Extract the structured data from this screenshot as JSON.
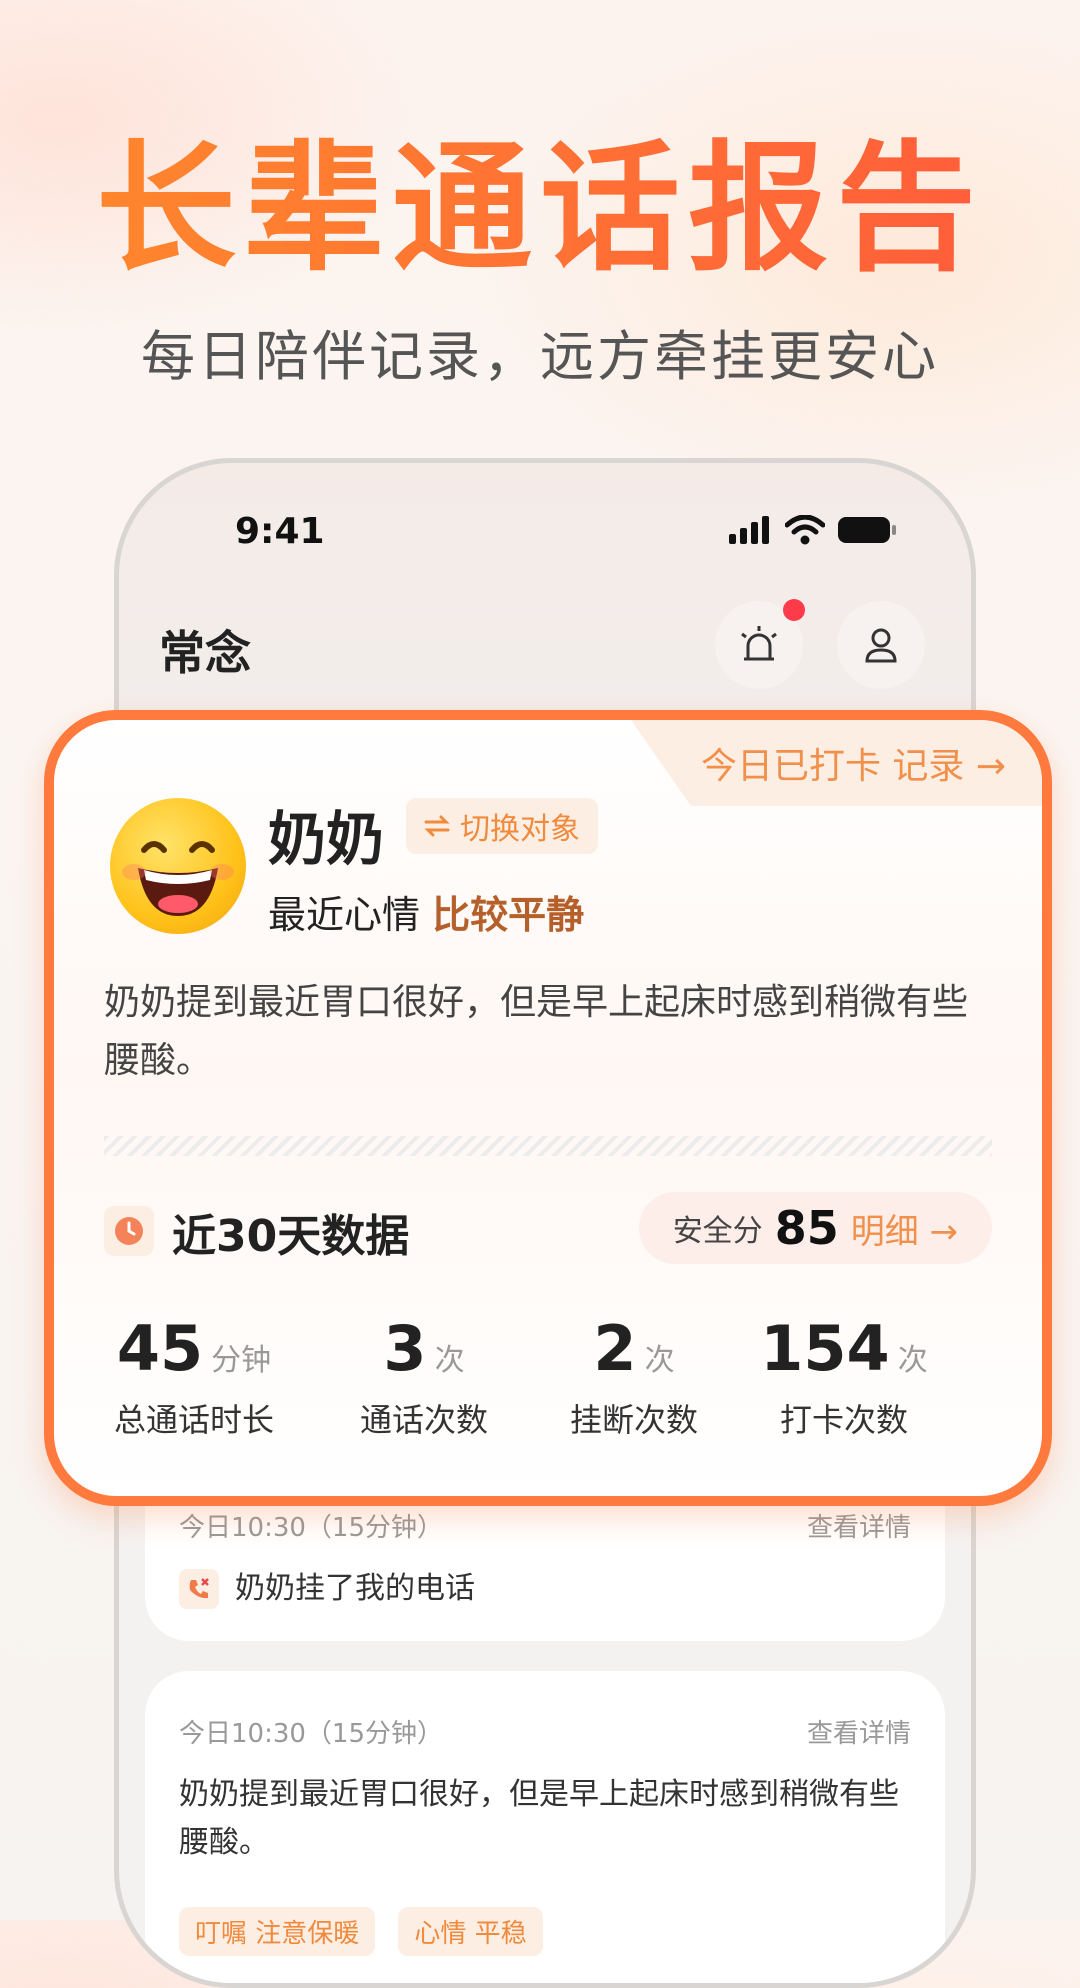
{
  "hero": {
    "title": "长辈通话报告",
    "subtitle": "每日陪伴记录，远方牵挂更安心"
  },
  "status_bar": {
    "time": "9:41"
  },
  "app": {
    "title": "常念"
  },
  "card": {
    "checkin": "今日已打卡 记录 →",
    "name": "奶奶",
    "switch_label": "切换对象",
    "mood_prefix": "最近心情",
    "mood_value": "比较平静",
    "summary": "奶奶提到最近胃口很好，但是早上起床时感到稍微有些腰酸。",
    "section_title": "近30天数据",
    "score_label": "安全分",
    "score_value": "85",
    "score_link": "明细 →",
    "stats": [
      {
        "value": "45",
        "unit": "分钟",
        "label": "总通话时长"
      },
      {
        "value": "3",
        "unit": "次",
        "label": "通话次数"
      },
      {
        "value": "2",
        "unit": "次",
        "label": "挂断次数"
      },
      {
        "value": "154",
        "unit": "次",
        "label": "打卡次数"
      }
    ]
  },
  "records": [
    {
      "time": "今日10:30（15分钟）",
      "detail": "查看详情",
      "text": "奶奶挂了我的电话"
    },
    {
      "time": "今日10:30（15分钟）",
      "detail": "查看详情",
      "text": "奶奶提到最近胃口很好，但是早上起床时感到稍微有些腰酸。",
      "tags": [
        "叮嘱 注意保暖",
        "心情 平稳"
      ]
    }
  ],
  "colors": {
    "accent": "#ff7a3c",
    "tag_bg": "#fdeee4",
    "tag_text": "#f08a3c"
  }
}
